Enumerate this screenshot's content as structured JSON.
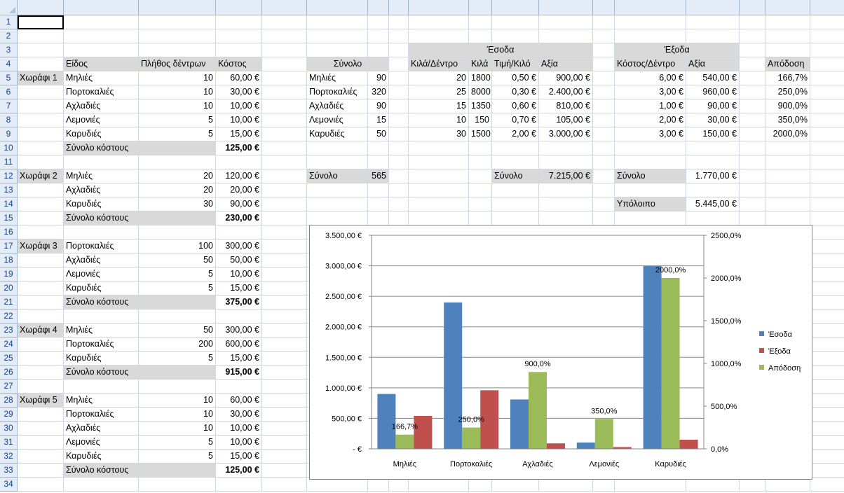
{
  "columns": [
    "A",
    "B",
    "C",
    "D",
    "E",
    "F",
    "G",
    "H",
    "I",
    "J",
    "K",
    "L",
    "M",
    "N",
    "O",
    "P",
    "Q",
    "R"
  ],
  "rows": 34,
  "selected_cell": "A1",
  "cells": [
    {
      "ref": "I3",
      "text": "Έσοδα",
      "span": "I3:L3",
      "align": "c",
      "fill": "gray"
    },
    {
      "ref": "N3",
      "text": "Έξοδα",
      "span": "N3:O3",
      "align": "c",
      "fill": "gray"
    },
    {
      "ref": "B4",
      "text": "Είδος",
      "fill": "gray"
    },
    {
      "ref": "C4",
      "text": "Πλήθος δέντρων",
      "fill": "gray"
    },
    {
      "ref": "D4",
      "text": "Κόστος",
      "fill": "gray"
    },
    {
      "ref": "F4",
      "text": "Σύνολο",
      "span": "F4:G4",
      "align": "c",
      "fill": "gray"
    },
    {
      "ref": "I4",
      "text": "Κιλά/Δέντρο",
      "fill": "gray"
    },
    {
      "ref": "J4",
      "text": "Κιλά",
      "fill": "gray"
    },
    {
      "ref": "K4",
      "text": "Τιμή/Κιλό",
      "fill": "gray"
    },
    {
      "ref": "L4",
      "text": "Αξία",
      "fill": "gray"
    },
    {
      "ref": "N4",
      "text": "Κόστος/Δέντρο",
      "fill": "gray"
    },
    {
      "ref": "O4",
      "text": "Αξία",
      "fill": "gray"
    },
    {
      "ref": "Q4",
      "text": "Απόδοση",
      "fill": "gray"
    },
    {
      "ref": "A5",
      "text": "Χωράφι 1",
      "fill": "gray"
    },
    {
      "ref": "B5",
      "text": "Μηλιές"
    },
    {
      "ref": "C5",
      "text": "10",
      "align": "r"
    },
    {
      "ref": "D5",
      "text": "60,00 €",
      "align": "r"
    },
    {
      "ref": "B6",
      "text": "Πορτοκαλιές"
    },
    {
      "ref": "C6",
      "text": "10",
      "align": "r"
    },
    {
      "ref": "D6",
      "text": "30,00 €",
      "align": "r"
    },
    {
      "ref": "B7",
      "text": "Αχλαδιές"
    },
    {
      "ref": "C7",
      "text": "10",
      "align": "r"
    },
    {
      "ref": "D7",
      "text": "10,00 €",
      "align": "r"
    },
    {
      "ref": "B8",
      "text": "Λεμονιές"
    },
    {
      "ref": "C8",
      "text": "5",
      "align": "r"
    },
    {
      "ref": "D8",
      "text": "10,00 €",
      "align": "r"
    },
    {
      "ref": "B9",
      "text": "Καρυδιές"
    },
    {
      "ref": "C9",
      "text": "5",
      "align": "r"
    },
    {
      "ref": "D9",
      "text": "15,00 €",
      "align": "r"
    },
    {
      "ref": "B10",
      "text": "Σύνολο κόστους",
      "span": "B10:C10",
      "fill": "gray"
    },
    {
      "ref": "D10",
      "text": "125,00 €",
      "align": "r",
      "bold": true
    },
    {
      "ref": "F5",
      "text": "Μηλιές"
    },
    {
      "ref": "G5",
      "text": "90",
      "align": "r"
    },
    {
      "ref": "F6",
      "text": "Πορτοκαλιές"
    },
    {
      "ref": "G6",
      "text": "320",
      "align": "r"
    },
    {
      "ref": "F7",
      "text": "Αχλαδιές"
    },
    {
      "ref": "G7",
      "text": "90",
      "align": "r"
    },
    {
      "ref": "F8",
      "text": "Λεμονιές"
    },
    {
      "ref": "G8",
      "text": "15",
      "align": "r"
    },
    {
      "ref": "F9",
      "text": "Καρυδιές"
    },
    {
      "ref": "G9",
      "text": "50",
      "align": "r"
    },
    {
      "ref": "I5",
      "text": "20",
      "align": "r"
    },
    {
      "ref": "J5",
      "text": "1800",
      "align": "r"
    },
    {
      "ref": "K5",
      "text": "0,50 €",
      "align": "r"
    },
    {
      "ref": "L5",
      "text": "900,00 €",
      "align": "r"
    },
    {
      "ref": "I6",
      "text": "25",
      "align": "r"
    },
    {
      "ref": "J6",
      "text": "8000",
      "align": "r"
    },
    {
      "ref": "K6",
      "text": "0,30 €",
      "align": "r"
    },
    {
      "ref": "L6",
      "text": "2.400,00 €",
      "align": "r"
    },
    {
      "ref": "I7",
      "text": "15",
      "align": "r"
    },
    {
      "ref": "J7",
      "text": "1350",
      "align": "r"
    },
    {
      "ref": "K7",
      "text": "0,60 €",
      "align": "r"
    },
    {
      "ref": "L7",
      "text": "810,00 €",
      "align": "r"
    },
    {
      "ref": "I8",
      "text": "10",
      "align": "r"
    },
    {
      "ref": "J8",
      "text": "150",
      "align": "r"
    },
    {
      "ref": "K8",
      "text": "0,70 €",
      "align": "r"
    },
    {
      "ref": "L8",
      "text": "105,00 €",
      "align": "r"
    },
    {
      "ref": "I9",
      "text": "30",
      "align": "r"
    },
    {
      "ref": "J9",
      "text": "1500",
      "align": "r"
    },
    {
      "ref": "K9",
      "text": "2,00 €",
      "align": "r"
    },
    {
      "ref": "L9",
      "text": "3.000,00 €",
      "align": "r"
    },
    {
      "ref": "N5",
      "text": "6,00 €",
      "align": "r"
    },
    {
      "ref": "O5",
      "text": "540,00 €",
      "align": "r"
    },
    {
      "ref": "Q5",
      "text": "166,7%",
      "align": "r"
    },
    {
      "ref": "N6",
      "text": "3,00 €",
      "align": "r"
    },
    {
      "ref": "O6",
      "text": "960,00 €",
      "align": "r"
    },
    {
      "ref": "Q6",
      "text": "250,0%",
      "align": "r"
    },
    {
      "ref": "N7",
      "text": "1,00 €",
      "align": "r"
    },
    {
      "ref": "O7",
      "text": "90,00 €",
      "align": "r"
    },
    {
      "ref": "Q7",
      "text": "900,0%",
      "align": "r"
    },
    {
      "ref": "N8",
      "text": "2,00 €",
      "align": "r"
    },
    {
      "ref": "O8",
      "text": "30,00 €",
      "align": "r"
    },
    {
      "ref": "Q8",
      "text": "350,0%",
      "align": "r"
    },
    {
      "ref": "N9",
      "text": "3,00 €",
      "align": "r"
    },
    {
      "ref": "O9",
      "text": "150,00 €",
      "align": "r"
    },
    {
      "ref": "Q9",
      "text": "2000,0%",
      "align": "r"
    },
    {
      "ref": "F12",
      "text": "Σύνολο",
      "fill": "gray"
    },
    {
      "ref": "G12",
      "text": "565",
      "align": "r",
      "fill": "gray"
    },
    {
      "ref": "K12",
      "text": "Σύνολο",
      "fill": "gray"
    },
    {
      "ref": "L12",
      "text": "7.215,00 €",
      "align": "r",
      "fill": "gray"
    },
    {
      "ref": "N12",
      "text": "Σύνολο",
      "fill": "gray"
    },
    {
      "ref": "O12",
      "text": "1.770,00 €",
      "align": "r"
    },
    {
      "ref": "N14",
      "text": "Υπόλοιπο",
      "fill": "gray"
    },
    {
      "ref": "O14",
      "text": "5.445,00 €",
      "align": "r"
    },
    {
      "ref": "A12",
      "text": "Χωράφι 2",
      "fill": "gray"
    },
    {
      "ref": "B12",
      "text": "Μηλιές"
    },
    {
      "ref": "C12",
      "text": "20",
      "align": "r"
    },
    {
      "ref": "D12",
      "text": "120,00 €",
      "align": "r"
    },
    {
      "ref": "B13",
      "text": "Αχλαδιές"
    },
    {
      "ref": "C13",
      "text": "20",
      "align": "r"
    },
    {
      "ref": "D13",
      "text": "20,00 €",
      "align": "r"
    },
    {
      "ref": "B14",
      "text": "Καρυδιές"
    },
    {
      "ref": "C14",
      "text": "30",
      "align": "r"
    },
    {
      "ref": "D14",
      "text": "90,00 €",
      "align": "r"
    },
    {
      "ref": "B15",
      "text": "Σύνολο κόστους",
      "span": "B15:C15",
      "fill": "gray"
    },
    {
      "ref": "D15",
      "text": "230,00 €",
      "align": "r",
      "bold": true
    },
    {
      "ref": "A17",
      "text": "Χωράφι 3",
      "fill": "gray"
    },
    {
      "ref": "B17",
      "text": "Πορτοκαλιές"
    },
    {
      "ref": "C17",
      "text": "100",
      "align": "r"
    },
    {
      "ref": "D17",
      "text": "300,00 €",
      "align": "r"
    },
    {
      "ref": "B18",
      "text": "Αχλαδιές"
    },
    {
      "ref": "C18",
      "text": "50",
      "align": "r"
    },
    {
      "ref": "D18",
      "text": "50,00 €",
      "align": "r"
    },
    {
      "ref": "B19",
      "text": "Λεμονιές"
    },
    {
      "ref": "C19",
      "text": "5",
      "align": "r"
    },
    {
      "ref": "D19",
      "text": "10,00 €",
      "align": "r"
    },
    {
      "ref": "B20",
      "text": "Καρυδιές"
    },
    {
      "ref": "C20",
      "text": "5",
      "align": "r"
    },
    {
      "ref": "D20",
      "text": "15,00 €",
      "align": "r"
    },
    {
      "ref": "B21",
      "text": "Σύνολο κόστους",
      "span": "B21:C21",
      "fill": "gray"
    },
    {
      "ref": "D21",
      "text": "375,00 €",
      "align": "r",
      "bold": true
    },
    {
      "ref": "A23",
      "text": "Χωράφι 4",
      "fill": "gray"
    },
    {
      "ref": "B23",
      "text": "Μηλιές"
    },
    {
      "ref": "C23",
      "text": "50",
      "align": "r"
    },
    {
      "ref": "D23",
      "text": "300,00 €",
      "align": "r"
    },
    {
      "ref": "B24",
      "text": "Πορτοκαλιές"
    },
    {
      "ref": "C24",
      "text": "200",
      "align": "r"
    },
    {
      "ref": "D24",
      "text": "600,00 €",
      "align": "r"
    },
    {
      "ref": "B25",
      "text": "Καρυδιές"
    },
    {
      "ref": "C25",
      "text": "5",
      "align": "r"
    },
    {
      "ref": "D25",
      "text": "15,00 €",
      "align": "r"
    },
    {
      "ref": "B26",
      "text": "Σύνολο κόστους",
      "span": "B26:C26",
      "fill": "gray"
    },
    {
      "ref": "D26",
      "text": "915,00 €",
      "align": "r",
      "bold": true
    },
    {
      "ref": "A28",
      "text": "Χωράφι 5",
      "fill": "gray"
    },
    {
      "ref": "B28",
      "text": "Μηλιές"
    },
    {
      "ref": "C28",
      "text": "10",
      "align": "r"
    },
    {
      "ref": "D28",
      "text": "60,00 €",
      "align": "r"
    },
    {
      "ref": "B29",
      "text": "Πορτοκαλιές"
    },
    {
      "ref": "C29",
      "text": "10",
      "align": "r"
    },
    {
      "ref": "D29",
      "text": "30,00 €",
      "align": "r"
    },
    {
      "ref": "B30",
      "text": "Αχλαδιές"
    },
    {
      "ref": "C30",
      "text": "10",
      "align": "r"
    },
    {
      "ref": "D30",
      "text": "10,00 €",
      "align": "r"
    },
    {
      "ref": "B31",
      "text": "Λεμονιές"
    },
    {
      "ref": "C31",
      "text": "5",
      "align": "r"
    },
    {
      "ref": "D31",
      "text": "10,00 €",
      "align": "r"
    },
    {
      "ref": "B32",
      "text": "Καρυδιές"
    },
    {
      "ref": "C32",
      "text": "5",
      "align": "r"
    },
    {
      "ref": "D32",
      "text": "15,00 €",
      "align": "r"
    },
    {
      "ref": "B33",
      "text": "Σύνολο κόστους",
      "span": "B33:C33",
      "fill": "gray"
    },
    {
      "ref": "D33",
      "text": "125,00 €",
      "align": "r",
      "bold": true
    }
  ],
  "chart_data": {
    "type": "bar",
    "categories": [
      "Μηλιές",
      "Πορτοκαλιές",
      "Αχλαδιές",
      "Λεμονιές",
      "Καρυδιές"
    ],
    "series": [
      {
        "name": "Έσοδα",
        "axis": "left",
        "color": "#4f81bd",
        "values": [
          900,
          2400,
          810,
          105,
          3000
        ]
      },
      {
        "name": "Έξοδα",
        "axis": "left",
        "color": "#c0504d",
        "values": [
          540,
          960,
          90,
          30,
          150
        ]
      },
      {
        "name": "Απόδοση",
        "axis": "right",
        "color": "#9bbb59",
        "values": [
          166.7,
          250,
          900,
          350,
          2000
        ]
      }
    ],
    "left_axis": {
      "min": 0,
      "max": 3500,
      "ticks": [
        "-   €",
        "500,00 €",
        "1.000,00 €",
        "1.500,00 €",
        "2.000,00 €",
        "2.500,00 €",
        "3.000,00 €",
        "3.500,00 €"
      ]
    },
    "right_axis": {
      "min": 0,
      "max": 2500,
      "ticks": [
        "0,0%",
        "500,0%",
        "1000,0%",
        "1500,0%",
        "2000,0%",
        "2500,0%"
      ]
    },
    "data_labels": [
      "166,7%",
      "250,0%",
      "900,0%",
      "350,0%",
      "2000,0%"
    ],
    "grid": true,
    "legend_position": "right"
  }
}
